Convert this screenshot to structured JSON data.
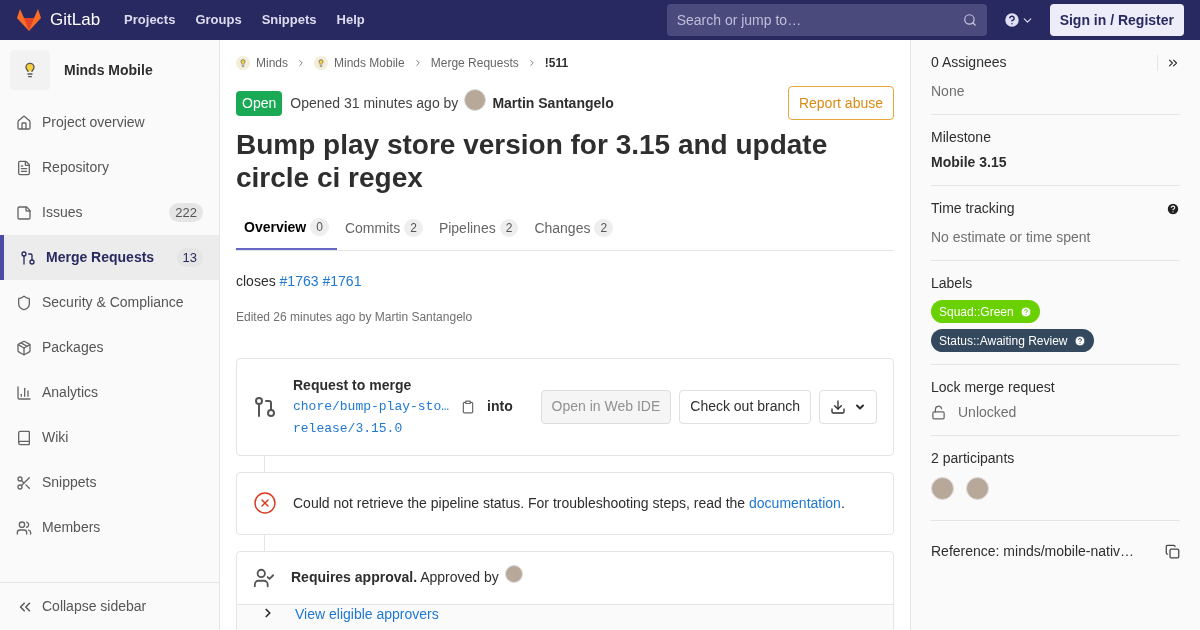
{
  "navbar": {
    "brand": "GitLab",
    "links": [
      "Projects",
      "Groups",
      "Snippets",
      "Help"
    ],
    "search": {
      "placeholder": "Search or jump to…"
    },
    "sign_in": "Sign in / Register"
  },
  "sidebar": {
    "project": "Minds Mobile",
    "items": [
      {
        "label": "Project overview",
        "selected": false
      },
      {
        "label": "Repository",
        "selected": false
      },
      {
        "label": "Issues",
        "count": "222",
        "selected": false
      },
      {
        "label": "Merge Requests",
        "count": "13",
        "selected": true
      },
      {
        "label": "Security & Compliance",
        "selected": false
      },
      {
        "label": "Packages",
        "selected": false
      },
      {
        "label": "Analytics",
        "selected": false
      },
      {
        "label": "Wiki",
        "selected": false
      },
      {
        "label": "Snippets",
        "selected": false
      },
      {
        "label": "Members",
        "selected": false
      }
    ],
    "collapse": "Collapse sidebar"
  },
  "breadcrumbs": [
    {
      "label": "Minds",
      "kind": "group"
    },
    {
      "label": "Minds Mobile",
      "kind": "group"
    },
    {
      "label": "Merge Requests",
      "kind": "plain"
    },
    {
      "label": "!511",
      "kind": "current"
    }
  ],
  "header": {
    "status": "Open",
    "opened": "Opened 31 minutes ago by",
    "author": "Martin Santangelo",
    "report": "Report abuse"
  },
  "title": "Bump play store version for 3.15 and update circle ci regex",
  "tabs": [
    {
      "label": "Overview",
      "count": "0",
      "selected": true
    },
    {
      "label": "Commits",
      "count": "2",
      "selected": false
    },
    {
      "label": "Pipelines",
      "count": "2",
      "selected": false
    },
    {
      "label": "Changes",
      "count": "2",
      "selected": false
    }
  ],
  "description": {
    "text": "closes",
    "links": [
      "#1763",
      "#1761"
    ],
    "edited": "Edited 26 minutes ago by Martin Santangelo"
  },
  "merge_widget": {
    "title": "Request to merge",
    "source": "chore/bump-play-sto…",
    "into": "into",
    "target": "release/3.15.0",
    "web_ide": {
      "label": "Open in Web IDE",
      "disabled": true
    },
    "checkout": "Check out branch"
  },
  "pipeline": {
    "text": "Could not retrieve the pipeline status. For troubleshooting steps, read the",
    "link": "documentation",
    "end": "."
  },
  "approval": {
    "text": "**Requires approval.** Approved by",
    "view": "View eligible approvers"
  },
  "right": {
    "assignees": {
      "title": "0 Assignees",
      "value": "None"
    },
    "milestone": {
      "title": "Milestone",
      "value": "Mobile 3.15"
    },
    "time_tracking": {
      "title": "Time tracking",
      "value": "No estimate or time spent"
    },
    "labels": {
      "title": "Labels",
      "items": [
        {
          "text": "Squad::Green",
          "color": "#69d100"
        },
        {
          "text": "Status::Awaiting Review",
          "color": "#34495e"
        }
      ]
    },
    "lock": {
      "title": "Lock merge request",
      "value": "Unlocked"
    },
    "participants": {
      "title": "2 participants",
      "avatars": [
        {
          "kind": "photo"
        },
        {
          "kind": "photo"
        }
      ]
    },
    "reference": "Reference: minds/mobile-nativ…"
  }
}
